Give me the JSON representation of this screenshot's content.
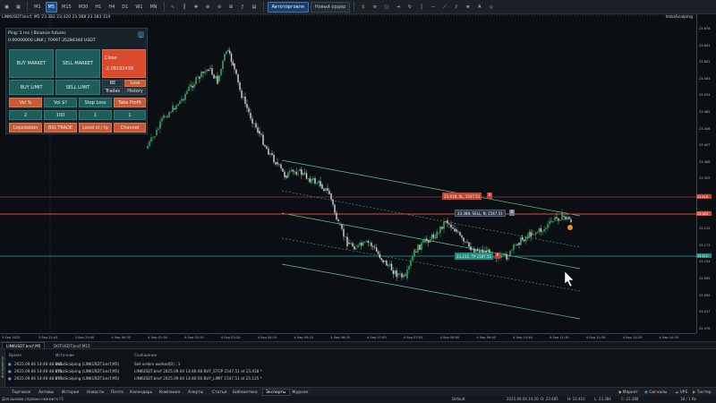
{
  "toolbar": {
    "timeframes": [
      "M1",
      "M5",
      "M15",
      "M30",
      "H1",
      "H4",
      "D1",
      "W1",
      "MN"
    ],
    "active_timeframe": "M5",
    "algo_button": "Автоторговля",
    "new_order_button": "Новый ордер"
  },
  "chart": {
    "symbol_label": "LINKUSDT.bncf, M5 23.382 23.420 23.368 23.383 314",
    "indicator_label": "ImbaScalping",
    "y_ticks": [
      "23.678",
      "23.641",
      "23.602",
      "23.563",
      "23.524",
      "23.485",
      "23.446",
      "23.407",
      "23.368",
      "23.329",
      "23.290",
      "23.251",
      "23.212",
      "23.173",
      "23.134",
      "23.095",
      "23.056",
      "23.017",
      "22.978"
    ],
    "x_ticks": [
      "3 Sep 2025",
      "3 Sep 22:45",
      "3 Sep 23:40",
      "4 Sep 00:35",
      "4 Sep 01:30",
      "4 Sep 02:25",
      "4 Sep 03:20",
      "4 Sep 04:15",
      "4 Sep 05:10",
      "4 Sep 06:05",
      "4 Sep 07:00",
      "4 Sep 07:55",
      "4 Sep 08:50",
      "4 Sep 09:45",
      "4 Sep 10:40",
      "4 Sep 11:35",
      "4 Sep 12:30",
      "4 Sep 13:25",
      "4 Sep 14:20"
    ],
    "price_tags": {
      "sl": "23.418",
      "current": "23.383",
      "tp": "23.212"
    },
    "sl_label": "23.418, SL, 1547.51",
    "sell_label": "23.388, SELL, N, 1547.51",
    "tp_label": "23.212, TP 1547.51",
    "close_x": "X"
  },
  "panel": {
    "ping": "Ping: 1 ms | Binance futures",
    "account": "0.00000000 LINK | 70997.35284340 USDT",
    "minimize": "_",
    "buy_market": "BUY MARKET",
    "sell_market": "SELL MARKET",
    "close_label": "Close",
    "close_value": "-2.09192438",
    "buy_limit": "BUY LIMIT",
    "sell_limit": "SELL LIMIT",
    "be": "BE",
    "loss": "Loss",
    "trades": "Trades",
    "history": "History",
    "vol_pct": "Vol %",
    "vol_usd": "Vol $?",
    "stop_loss": "Stop Loss",
    "take_profit": "Take Profit",
    "val_vol_pct": "2",
    "val_vol_usd": "100",
    "val_sl": "1",
    "val_tp": "1",
    "liquidation": "Liquidation",
    "big_trade": "BIG TRADE",
    "level_sl_tp": "Level sl / tp",
    "channel": "Channel"
  },
  "chart_tabs": [
    "LINKUSDT.bncf,M5",
    "DOTUSDT.bncf,M15"
  ],
  "toolbox": {
    "side_label": "Инструменты",
    "headers": {
      "time": "Время",
      "source": "Источник",
      "message": "Сообщение"
    },
    "rows": [
      {
        "time": "2025.09.04 14:46:48.065",
        "source": "ImbaScalping (LINKUSDT.bncf,M5)",
        "message": "Sell orders worked(0) : 1"
      },
      {
        "time": "2025.09.04 14:46:48.075",
        "source": "ImbaScalping (LINKUSDT.bncf,M5)",
        "message": "LINKUSDT.bncf 2025.09.04 14:46:48 BUY_STOP 1547.51 at 23.418 *"
      },
      {
        "time": "2025.09.04 14:46:48.077",
        "source": "ImbaScalping (LINKUSDT.bncf,M5)",
        "message": "LINKUSDT.bncf 2025.09.04 14:46:56 BUY_LIMIT 1547.51 at 23.125 *"
      }
    ]
  },
  "bottom_tabs": [
    "Торговля",
    "Активы",
    "История",
    "Новости",
    "Почта",
    "Календарь",
    "Компания",
    "Алерты",
    "Статьи",
    "Библиотека",
    "Эксперты",
    "Журнал"
  ],
  "active_bottom_tab": "Эксперты",
  "bottom_right": {
    "market": "Маркет",
    "signals": "Сигналы",
    "vps": "VPS",
    "tester": "Тестер"
  },
  "status": {
    "help": "Для вызова справки нажмите F1",
    "profile": "Default",
    "datetime": "2025.09.04 14:20",
    "o": "O: 23.485",
    "h": "H: 23.410",
    "l": "L: 23.384",
    "c": "C: 23.388",
    "traffic": "18 / 1 Kb"
  }
}
